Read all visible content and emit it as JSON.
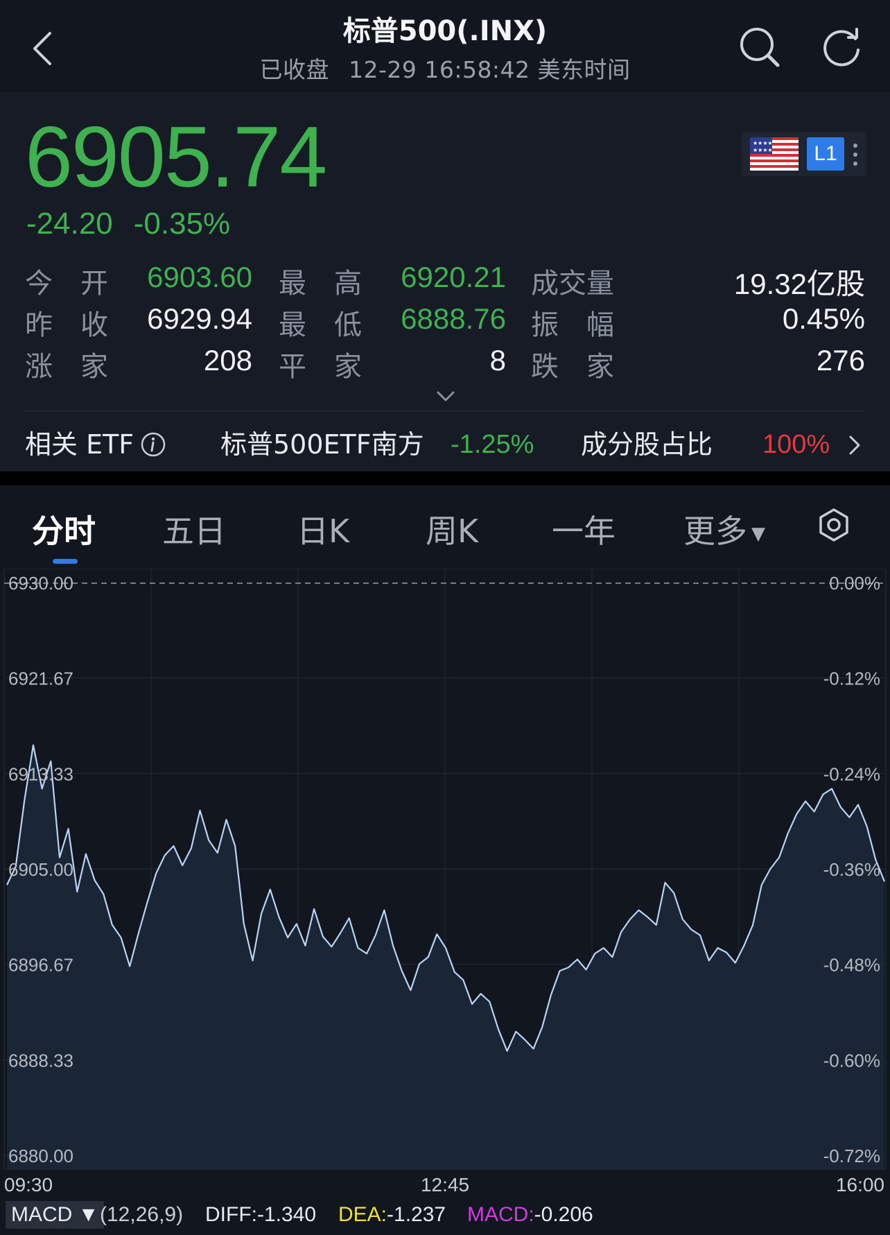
{
  "header": {
    "title": "标普500(.INX)",
    "status": "已收盘",
    "datetime": "12-29 16:58:42 美东时间"
  },
  "quote": {
    "price": "6905.74",
    "change": "-24.20",
    "change_pct": "-0.35%",
    "badge_level": "L1",
    "stats": [
      [
        {
          "label": "今开",
          "value": "6903.60",
          "color": "#3fb24f"
        },
        {
          "label": "最高",
          "value": "6920.21",
          "color": "#3fb24f"
        },
        {
          "label": "成交量",
          "value": "19.32亿股",
          "color": "#f2f4f7"
        }
      ],
      [
        {
          "label": "昨收",
          "value": "6929.94",
          "color": "#f2f4f7"
        },
        {
          "label": "最低",
          "value": "6888.76",
          "color": "#3fb24f"
        },
        {
          "label": "振幅",
          "value": "0.45%",
          "color": "#f2f4f7"
        }
      ],
      [
        {
          "label": "涨家",
          "value": "208",
          "color": "#f2f4f7"
        },
        {
          "label": "平家",
          "value": "8",
          "color": "#f2f4f7"
        },
        {
          "label": "跌家",
          "value": "276",
          "color": "#f2f4f7"
        }
      ]
    ]
  },
  "etf": {
    "label": "相关 ETF",
    "name": "标普500ETF南方",
    "change": "-1.25%",
    "comp_label": "成分股占比",
    "comp_value": "100%"
  },
  "tabs": [
    {
      "label": "分时",
      "active": true
    },
    {
      "label": "五日",
      "active": false
    },
    {
      "label": "日K",
      "active": false
    },
    {
      "label": "周K",
      "active": false
    },
    {
      "label": "一年",
      "active": false
    },
    {
      "label": "更多",
      "active": false
    }
  ],
  "chart_data": {
    "type": "area",
    "y_left_ticks": [
      "6930.00",
      "6921.67",
      "6913.33",
      "6905.00",
      "6896.67",
      "6888.33",
      "6880.00"
    ],
    "y_right_ticks": [
      "0.00%",
      "-0.12%",
      "-0.24%",
      "-0.36%",
      "-0.48%",
      "-0.60%",
      "-0.72%"
    ],
    "x_ticks": [
      "09:30",
      "12:45",
      "16:00"
    ],
    "ylim": [
      6880.0,
      6930.0
    ],
    "previous_close": 6929.94,
    "line_color": "#b9d4f5",
    "values": [
      6903.6,
      6905.2,
      6911.0,
      6915.8,
      6912.0,
      6914.4,
      6906.0,
      6908.5,
      6903.0,
      6906.3,
      6904.0,
      6902.8,
      6900.1,
      6899.0,
      6896.5,
      6899.4,
      6902.1,
      6904.6,
      6906.2,
      6907.0,
      6905.3,
      6906.8,
      6910.1,
      6907.5,
      6906.4,
      6909.3,
      6907.0,
      6900.2,
      6897.0,
      6901.1,
      6903.2,
      6900.8,
      6899.0,
      6900.2,
      6898.3,
      6901.5,
      6899.1,
      6898.2,
      6899.4,
      6900.7,
      6898.1,
      6897.6,
      6899.2,
      6901.4,
      6898.3,
      6896.1,
      6894.4,
      6896.7,
      6897.3,
      6899.3,
      6898.1,
      6896.0,
      6895.3,
      6893.2,
      6894.1,
      6893.4,
      6891.0,
      6889.1,
      6890.8,
      6890.1,
      6889.3,
      6891.2,
      6894.0,
      6896.1,
      6896.4,
      6897.1,
      6896.2,
      6897.6,
      6898.1,
      6897.3,
      6899.5,
      6900.6,
      6901.4,
      6900.8,
      6900.1,
      6903.8,
      6902.9,
      6900.6,
      6899.7,
      6899.2,
      6897.0,
      6898.1,
      6897.7,
      6896.8,
      6898.3,
      6900.1,
      6903.6,
      6905.0,
      6906.0,
      6908.1,
      6909.8,
      6910.9,
      6910.0,
      6911.5,
      6912.0,
      6910.4,
      6909.5,
      6910.6,
      6908.7,
      6905.8,
      6903.9
    ]
  },
  "macd": {
    "indicator": "MACD",
    "params": "(12,26,9)",
    "diff_label": "DIFF:",
    "diff_value": "-1.340",
    "dea_label": "DEA:",
    "dea_value": "-1.237",
    "macd_label": "MACD:",
    "macd_value": "-0.206"
  }
}
